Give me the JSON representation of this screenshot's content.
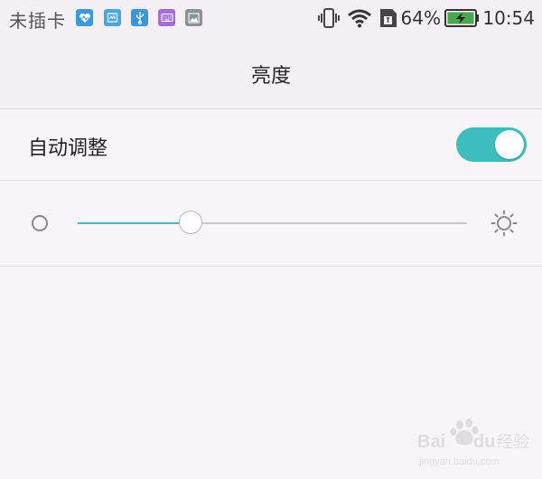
{
  "status_bar": {
    "carrier": "未插卡",
    "battery_percent": "64%",
    "time": "10:54",
    "notification_icons": [
      "health-icon",
      "clipboard-icon",
      "usb-icon",
      "keyboard-icon",
      "gallery-icon"
    ],
    "status_icons": [
      "vibrate-icon",
      "wifi-icon",
      "no-sim-icon",
      "battery-charging-icon"
    ]
  },
  "header": {
    "title": "亮度"
  },
  "auto_adjust": {
    "label": "自动调整",
    "enabled": true
  },
  "brightness": {
    "level": 0.29
  },
  "watermark": {
    "text": "Bai du 经验",
    "url_text": "jingyan.baidu.com"
  },
  "colors": {
    "accent": "#3dbdbd",
    "toggle_on": "#3dbdbd",
    "icon_gray": "#888888",
    "background": "#f7f5f8"
  }
}
